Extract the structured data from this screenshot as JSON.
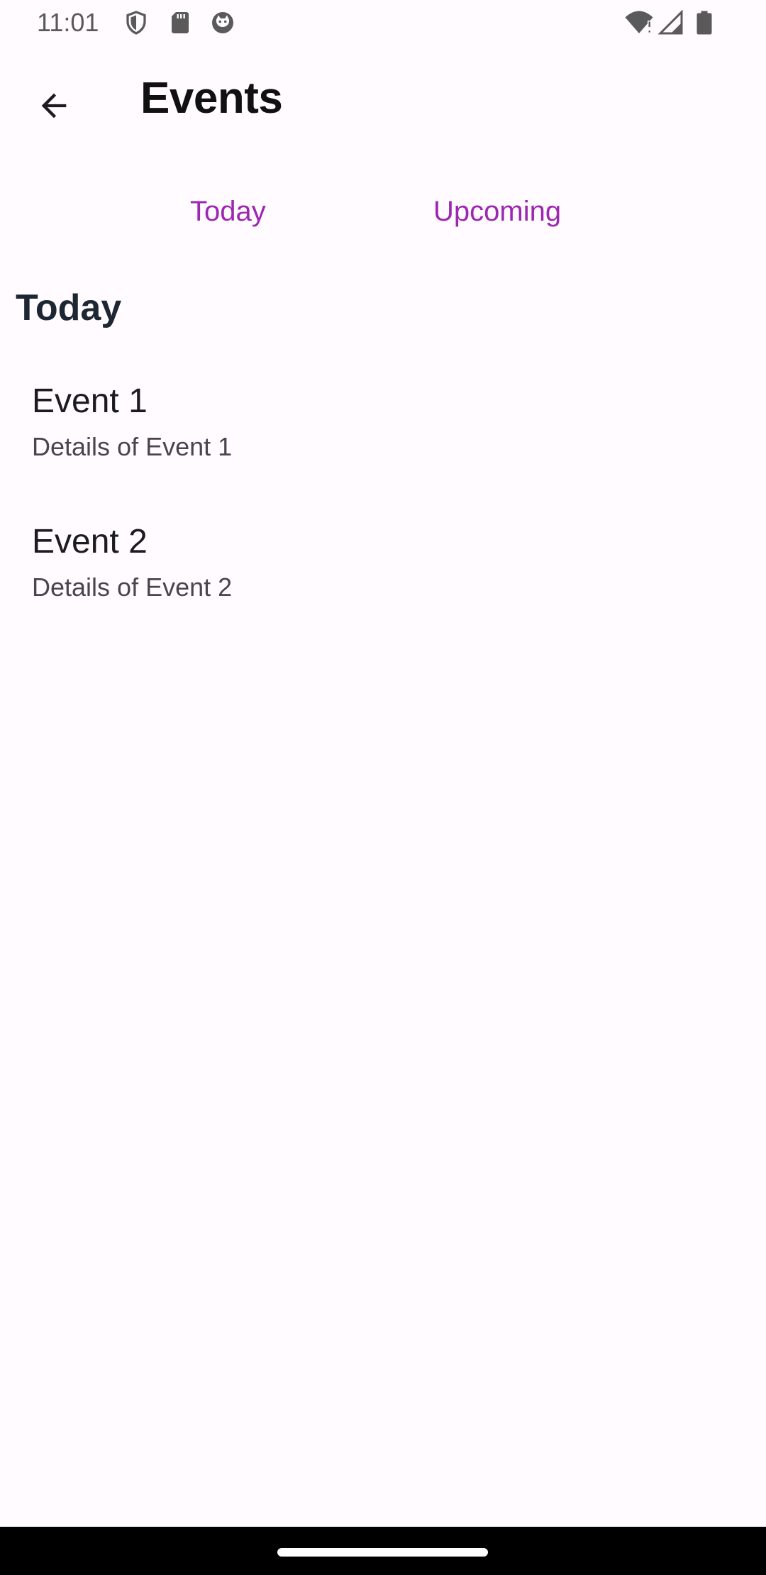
{
  "status_bar": {
    "time": "11:01",
    "icons": [
      "shield-icon",
      "sd-card-icon",
      "cat-face-icon",
      "wifi-icon",
      "signal-icon",
      "battery-icon"
    ]
  },
  "app_bar": {
    "back_icon": "arrow-back-icon",
    "title": "Events"
  },
  "tabs": [
    {
      "label": "Today"
    },
    {
      "label": "Upcoming"
    }
  ],
  "section": {
    "heading": "Today",
    "events": [
      {
        "title": "Event 1",
        "details": "Details of Event 1"
      },
      {
        "title": "Event 2",
        "details": "Details of Event 2"
      }
    ]
  },
  "colors": {
    "background": "#fffbfe",
    "tab_text": "#9c27b0",
    "heading": "#1c2733",
    "nav_bar": "#000000"
  }
}
